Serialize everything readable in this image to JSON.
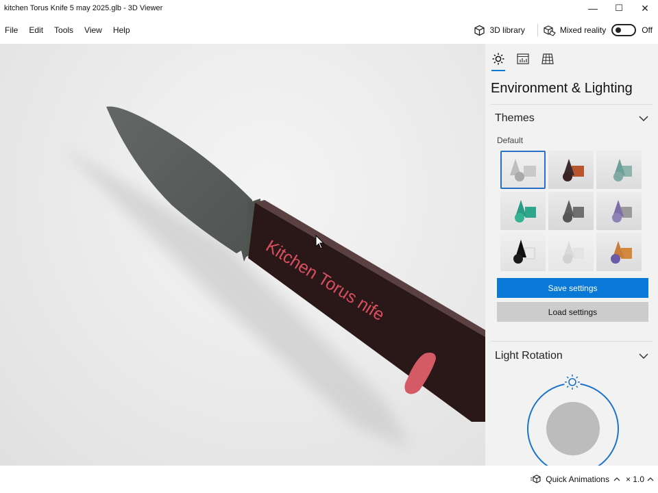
{
  "window": {
    "title": "kitchen Torus Knife  5 may 2025.glb - 3D Viewer",
    "controls": [
      "—",
      "☐",
      "✕"
    ]
  },
  "menu": {
    "items": [
      "File",
      "Edit",
      "Tools",
      "View",
      "Help"
    ],
    "library_label": "3D library",
    "mixed_reality_label": "Mixed reality",
    "mixed_reality_state": "Off"
  },
  "scene": {
    "handle_text": "Kitchen Torus nife",
    "text_color": "#d8505f",
    "handle_color": "#2a1717",
    "blade_color": "#5a5e5c"
  },
  "panel": {
    "active_tab": "environment-lighting",
    "title": "Environment & Lighting",
    "themes_header": "Themes",
    "themes_sub": "Default",
    "theme_count": 9,
    "selected_theme_index": 0,
    "save_label": "Save settings",
    "load_label": "Load settings",
    "light_rotation_header": "Light Rotation"
  },
  "statusbar": {
    "quick_animations_label": "Quick Animations",
    "zoom_label": "× 1.0"
  },
  "colors": {
    "accent": "#0a78d7",
    "panel_bg": "#f2f2f2"
  }
}
